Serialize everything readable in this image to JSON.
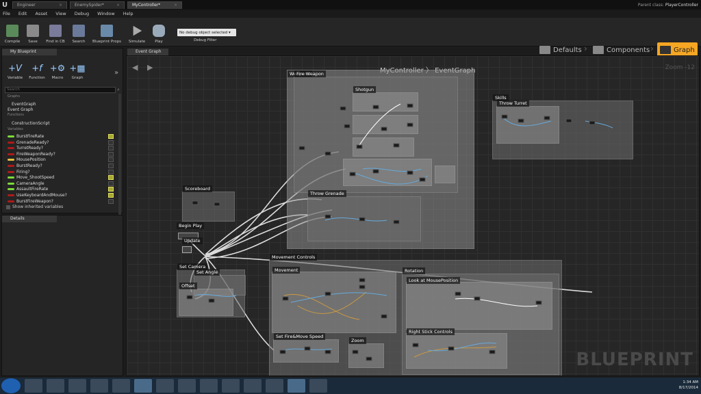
{
  "titlebar": {
    "tabs": [
      {
        "label": "Engineer"
      },
      {
        "label": "EnemySpider*"
      },
      {
        "label": "MyController*"
      }
    ],
    "parent_class_label": "Parent class:",
    "parent_class_value": "PlayerController"
  },
  "menu": [
    "File",
    "Edit",
    "Asset",
    "View",
    "Debug",
    "Window",
    "Help"
  ],
  "toolbar": {
    "compile": "Compile",
    "save": "Save",
    "find_in_cb": "Find in CB",
    "search": "Search",
    "blueprint_props": "Blueprint Props",
    "simulate": "Simulate",
    "play": "Play",
    "debug_select": "No debug object selected ▾",
    "debug_filter": "Debug Filter"
  },
  "modes": {
    "defaults": "Defaults",
    "components": "Components",
    "graph": "Graph"
  },
  "my_blueprint": {
    "tab": "My Blueprint",
    "tools": [
      "Variable",
      "Function",
      "Macro",
      "Graph"
    ],
    "search_placeholder": "Search",
    "cat_graphs": "Graphs",
    "graph_item": "EventGraph",
    "event_graph": "Event Graph",
    "cat_functions": "Functions",
    "construction": "ConstructionScript",
    "cat_variables": "Variables",
    "variables": [
      {
        "name": "BurstFireRate",
        "color": "#7ddb3a",
        "checked": true
      },
      {
        "name": "GrenadeReady?",
        "color": "#b01a1a",
        "checked": false
      },
      {
        "name": "TurretReady?",
        "color": "#b01a1a",
        "checked": false
      },
      {
        "name": "FireWeaponReady?",
        "color": "#b01a1a",
        "checked": false
      },
      {
        "name": "MousePosition",
        "color": "#e8c040",
        "checked": false
      },
      {
        "name": "BurstReady?",
        "color": "#b01a1a",
        "checked": false
      },
      {
        "name": "Firing?",
        "color": "#b01a1a",
        "checked": false
      },
      {
        "name": "Move_ShootSpeed",
        "color": "#7ddb3a",
        "checked": true
      },
      {
        "name": "CameraAngle",
        "color": "#7ddb3a",
        "checked": false
      },
      {
        "name": "AssaultFireRate",
        "color": "#7ddb3a",
        "checked": true
      },
      {
        "name": "UseKeyboardAndMouse?",
        "color": "#b01a1a",
        "checked": true
      },
      {
        "name": "BurstFireWeapon?",
        "color": "#b01a1a",
        "checked": false
      }
    ],
    "show_inherited": "Show inherited variables"
  },
  "details": {
    "tab": "Details"
  },
  "graph": {
    "tab": "Event Graph",
    "breadcrumb": "MyController  〉 EventGraph",
    "zoom": "Zoom -12",
    "watermark": "BLUEPRINT",
    "comments": {
      "weapons": "Weapons",
      "fire_weapon": "Fire Weapon",
      "shotgun": "Shotgun",
      "throw_grenade": "Throw Grenade",
      "skills": "Skills",
      "throw_turret": "Throw Turret",
      "scoreboard": "Scoreboard",
      "begin_play": "Begin Play",
      "update": "Update",
      "set_camera": "Set Camera",
      "set_angle": "Set Angle",
      "offset": "Offset",
      "movement_controls": "Movement Controls",
      "movement": "Movement",
      "rotation": "Rotation",
      "look_at_mouse": "Look at MousePosition",
      "right_stick": "Right Stick Controls",
      "set_fire_move": "Set Fire&Move Speed",
      "zoom": "Zoom"
    }
  },
  "taskbar": {
    "time": "1:34 AM",
    "date": "8/17/2014"
  }
}
